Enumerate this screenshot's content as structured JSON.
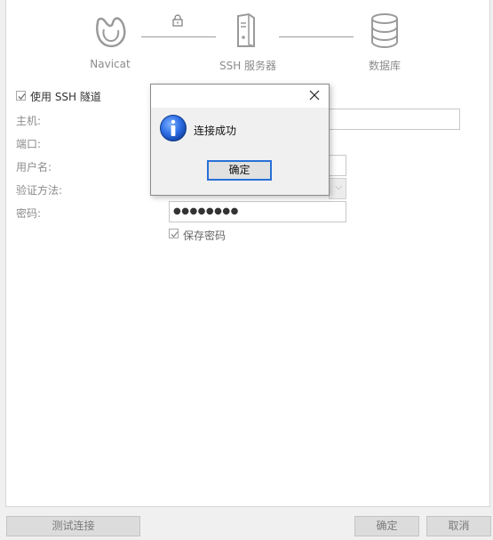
{
  "diagram": {
    "navicat_label": "Navicat",
    "ssh_label": "SSH 服务器",
    "db_label": "数据库"
  },
  "form": {
    "use_ssh_label": "使用 SSH 隧道",
    "use_ssh_checked": true,
    "host_label": "主机:",
    "port_label": "端口:",
    "username_label": "用户名:",
    "auth_method_label": "验证方法:",
    "password_label": "密码:",
    "password_value": "●●●●●●●●",
    "save_password_label": "保存密码",
    "save_password_checked": true
  },
  "buttons": {
    "test_connection": "测试连接",
    "ok": "确定",
    "cancel": "取消"
  },
  "dialog": {
    "message": "连接成功",
    "ok_label": "确定"
  },
  "icons": {
    "navicat": "navicat-logo-icon",
    "lock": "lock-icon",
    "server": "server-icon",
    "database": "database-icon",
    "info": "info-icon",
    "close": "close-icon"
  }
}
